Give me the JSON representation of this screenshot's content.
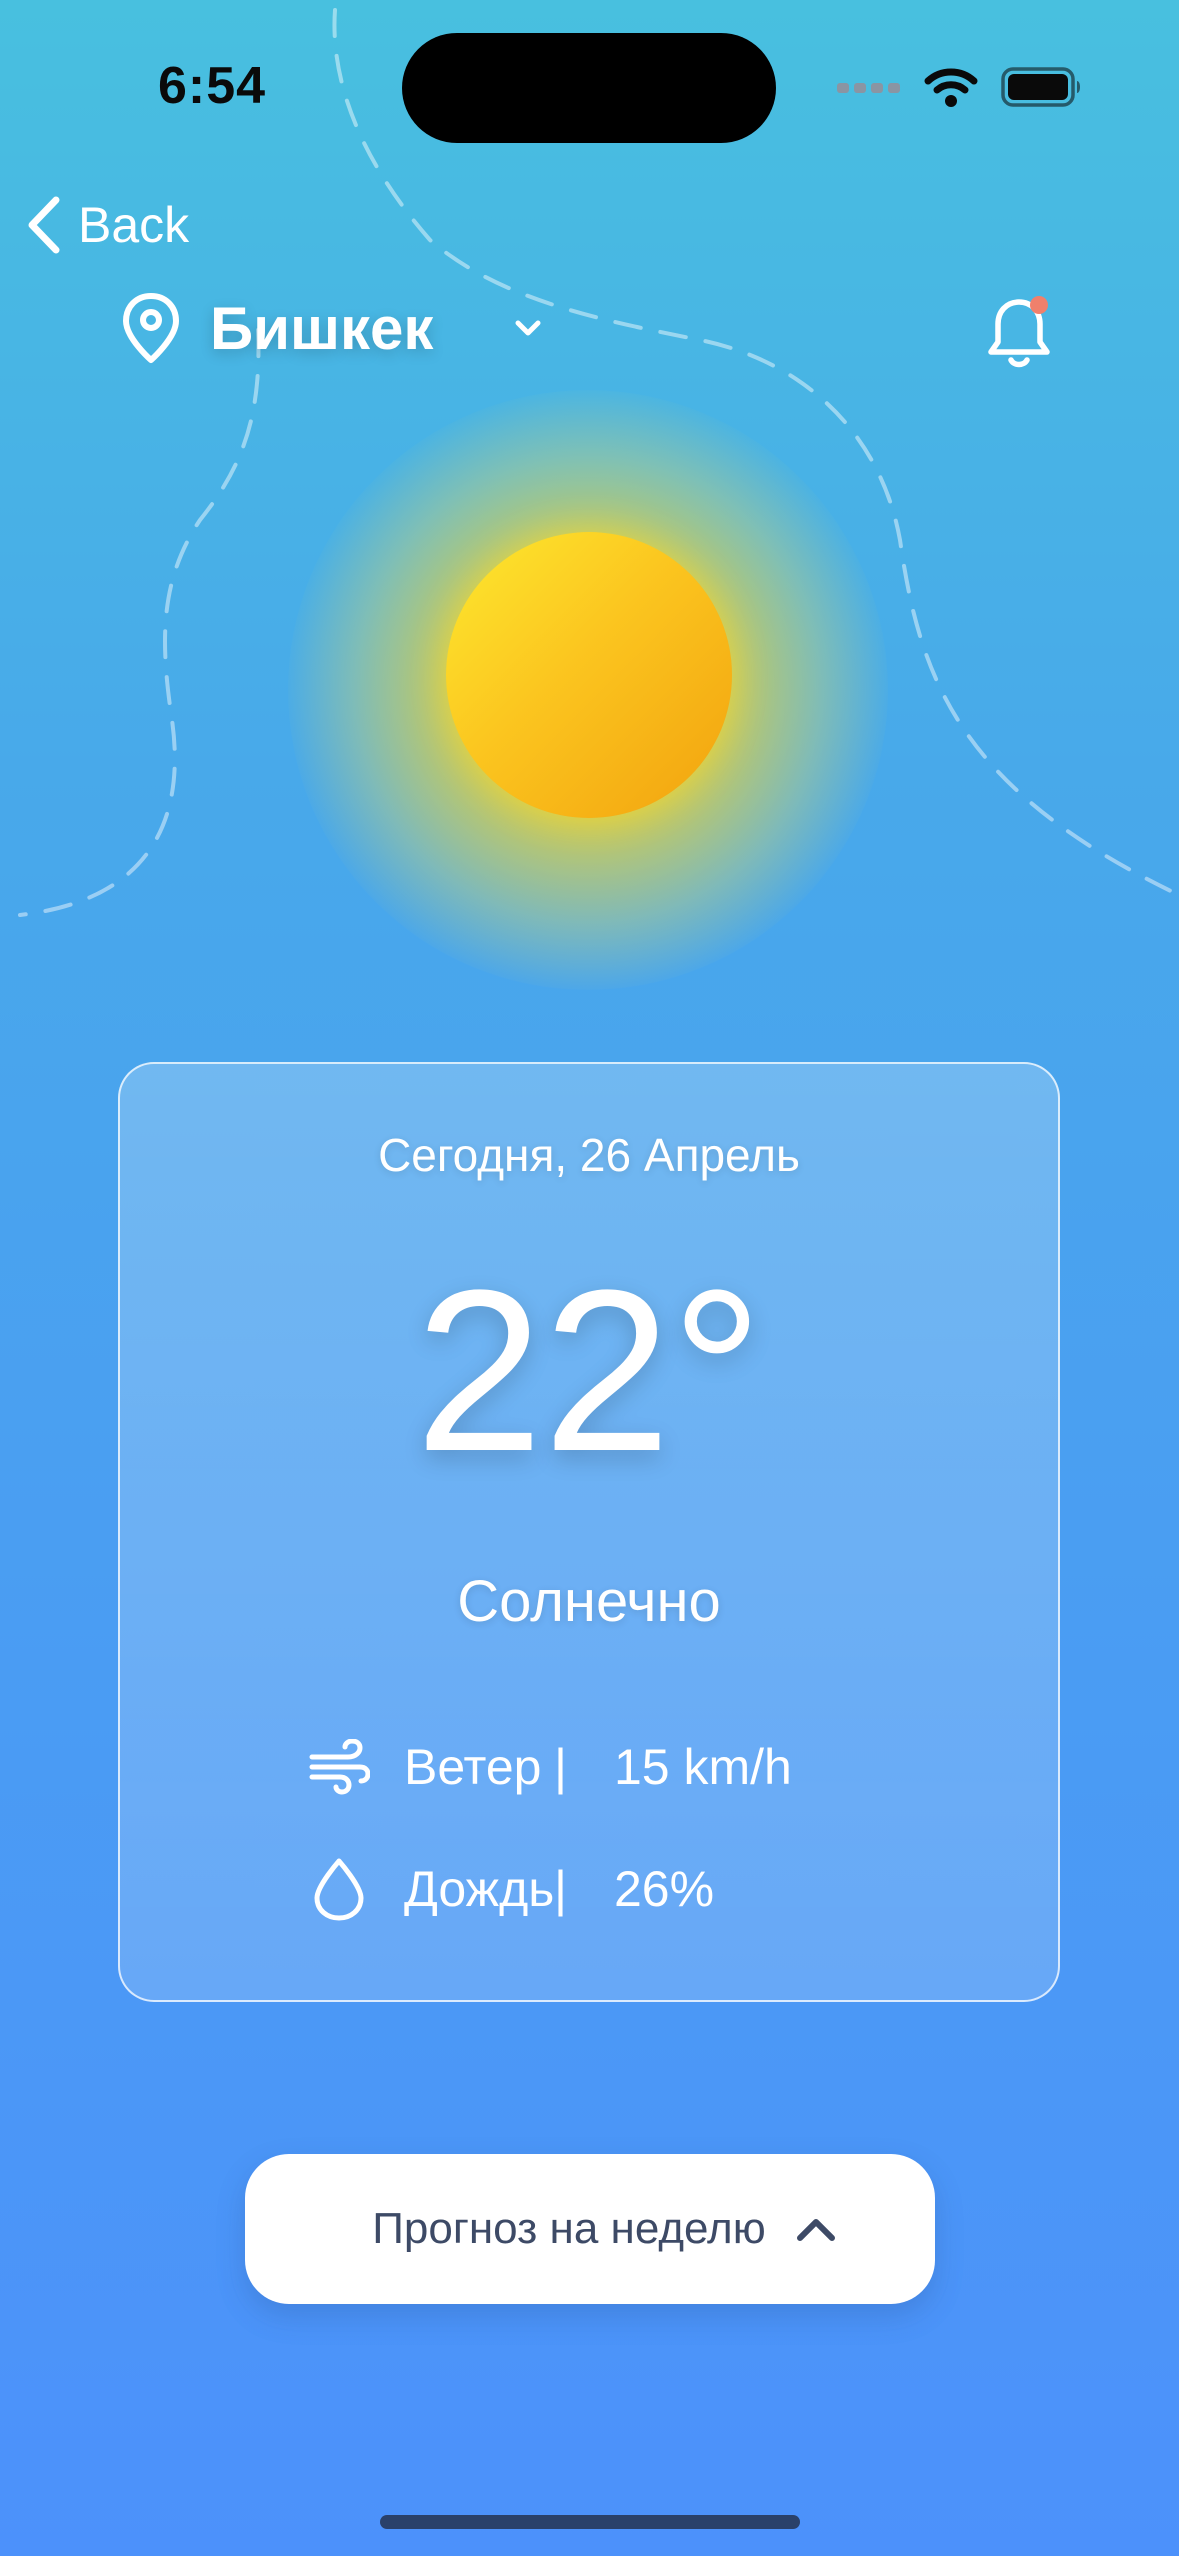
{
  "status_bar": {
    "time": "6:54"
  },
  "nav": {
    "back_label": "Back",
    "city": "Бишкек"
  },
  "weather": {
    "date": "Сегодня, 26 Апрель",
    "temperature": "22°",
    "condition": "Солнечно",
    "wind": {
      "label": "Ветер",
      "separator": "|",
      "value": "15 km/h"
    },
    "rain": {
      "label": "Дождь",
      "separator": "|",
      "value": "26%"
    }
  },
  "forecast_button": {
    "label": "Прогноз на неделю"
  },
  "colors": {
    "background_top": "#48c0df",
    "background_bottom": "#4c91fb",
    "notification_dot": "#f0806c",
    "sun": "#fbc51f",
    "button_text": "#3d4a66"
  },
  "icons": {
    "back": "chevron-left-icon",
    "location": "location-pin-icon",
    "dropdown": "chevron-down-icon",
    "notifications": "bell-icon",
    "wind": "wind-icon",
    "rain": "droplet-icon",
    "forecast_toggle": "chevron-up-icon"
  }
}
